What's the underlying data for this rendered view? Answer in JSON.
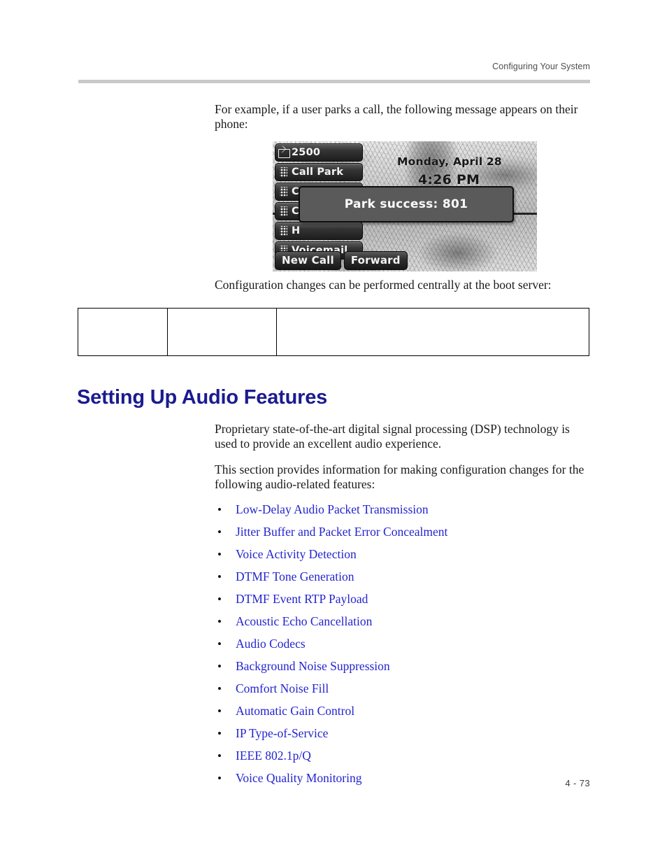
{
  "header": {
    "running_head": "Configuring Your System"
  },
  "intro": {
    "paragraph": "For example, if a user parks a call, the following message appears on their phone:"
  },
  "phone_figure": {
    "date": "Monday, April 28",
    "time": "4:26 PM",
    "popup_message": "Park success: 801",
    "line_keys": [
      {
        "label": "2500",
        "icon": "envelope-icon"
      },
      {
        "label": "Call Park",
        "icon": "blf-grid-icon"
      },
      {
        "label": "Call Pickup",
        "icon": "blf-grid-icon"
      },
      {
        "label": "C",
        "icon": "blf-grid-icon"
      },
      {
        "label": "H",
        "icon": "blf-grid-icon"
      },
      {
        "label": "Voicemail",
        "icon": "blf-grid-icon"
      }
    ],
    "soft_keys": [
      "New Call",
      "Forward"
    ]
  },
  "after_figure": {
    "paragraph": "Configuration changes can be performed centrally at the boot server:"
  },
  "config_table": {
    "rows": [
      {
        "cells": [
          "",
          "",
          ""
        ]
      }
    ]
  },
  "section": {
    "heading": "Setting Up Audio Features",
    "paragraph_1": "Proprietary state-of-the-art digital signal processing (DSP) technology is used to provide an excellent audio experience.",
    "paragraph_2": "This section provides information for making configuration changes for the following audio-related features:",
    "bullet": "•",
    "links": [
      "Low-Delay Audio Packet Transmission",
      "Jitter Buffer and Packet Error Concealment",
      "Voice Activity Detection",
      "DTMF Tone Generation",
      "DTMF Event RTP Payload",
      "Acoustic Echo Cancellation",
      "Audio Codecs",
      "Background Noise Suppression",
      "Comfort Noise Fill",
      "Automatic Gain Control",
      "IP Type-of-Service",
      "IEEE 802.1p/Q",
      "Voice Quality Monitoring"
    ]
  },
  "footer": {
    "page_number": "4 - 73"
  },
  "colors": {
    "heading": "#1b1b8f",
    "link": "#2424cf",
    "rule": "#c9c9c9",
    "body_text": "#1a1a1a"
  }
}
